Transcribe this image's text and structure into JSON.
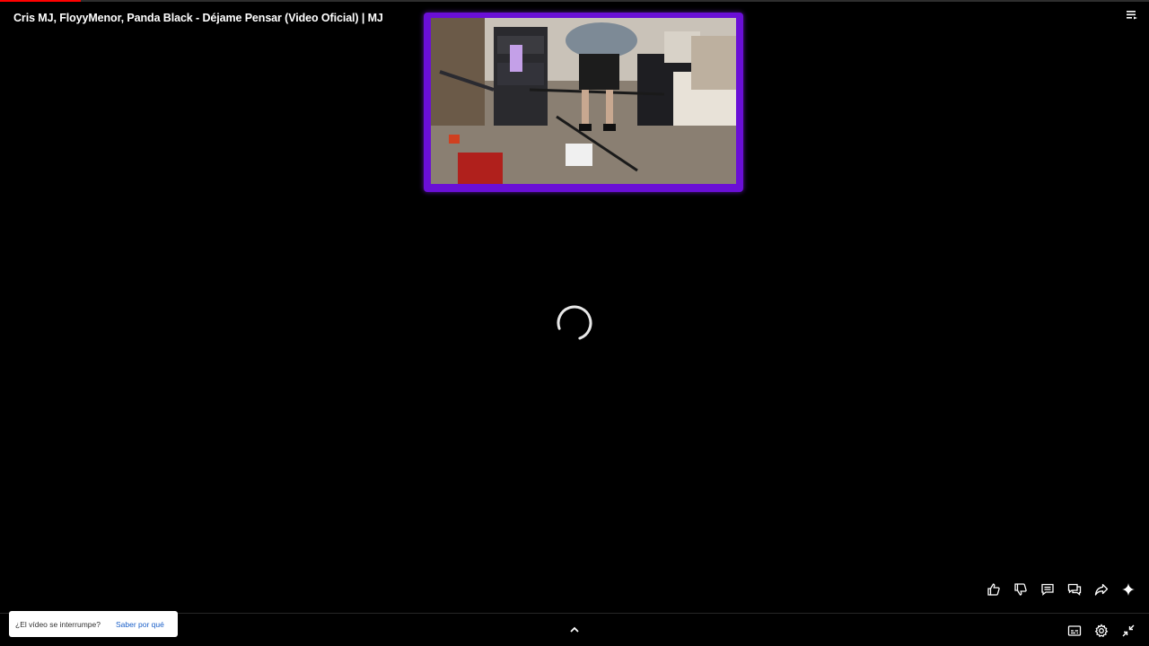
{
  "player": {
    "title": "Cris MJ, FloyyMenor, Panda Black - Déjame Pensar (Video Oficial) | MJ",
    "progress_percent": 7,
    "state": "loading"
  },
  "icons": {
    "playlist": "playlist-icon",
    "like": "thumbs-up-icon",
    "dislike": "thumbs-down-icon",
    "comments": "comments-icon",
    "remix": "remix-icon",
    "share": "share-icon",
    "ask": "sparkle-icon",
    "expand": "chevron-up-icon",
    "captions": "captions-icon",
    "settings": "gear-icon",
    "exit_fullscreen": "exit-fullscreen-icon"
  },
  "notice": {
    "question": "¿El vídeo se interrumpe?",
    "link_label": "Saber por qué"
  },
  "colors": {
    "progress": "#ff0000",
    "thumbnail_border": "#6a0fd6",
    "link": "#1a5fc8"
  }
}
